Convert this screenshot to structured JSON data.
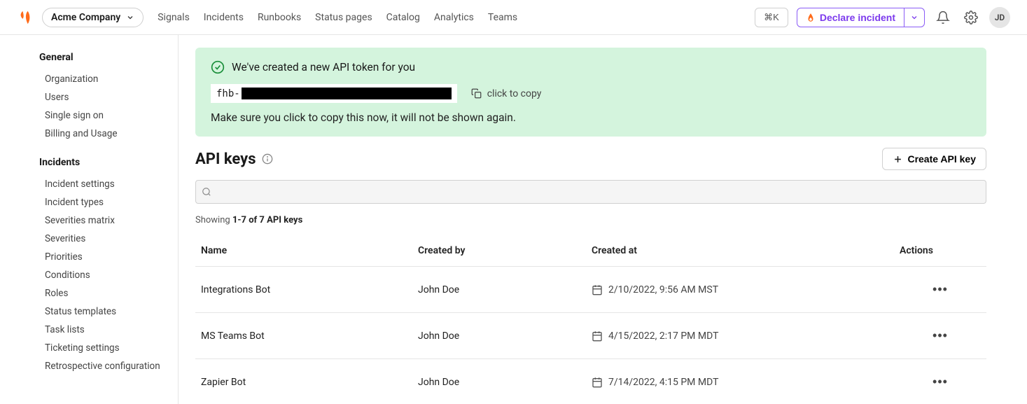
{
  "header": {
    "company": "Acme Company",
    "nav": [
      "Signals",
      "Incidents",
      "Runbooks",
      "Status pages",
      "Catalog",
      "Analytics",
      "Teams"
    ],
    "cmdKey": "⌘K",
    "declare": "Declare incident",
    "avatar": "JD"
  },
  "sidebar": {
    "sections": [
      {
        "title": "General",
        "items": [
          "Organization",
          "Users",
          "Single sign on",
          "Billing and Usage"
        ]
      },
      {
        "title": "Incidents",
        "items": [
          "Incident settings",
          "Incident types",
          "Severities matrix",
          "Severities",
          "Priorities",
          "Conditions",
          "Roles",
          "Status templates",
          "Task lists",
          "Ticketing settings",
          "Retrospective configuration"
        ]
      }
    ]
  },
  "banner": {
    "title": "We've created a new API token for you",
    "tokenPrefix": "fhb-",
    "copyLabel": "click to copy",
    "note": "Make sure you click to copy this now, it will not be shown again."
  },
  "page": {
    "title": "API keys",
    "createBtn": "Create API key",
    "showingPrefix": "Showing ",
    "showingBold": "1-7 of 7 API keys"
  },
  "table": {
    "columns": [
      "Name",
      "Created by",
      "Created at",
      "Actions"
    ],
    "rows": [
      {
        "name": "Integrations Bot",
        "createdBy": "John Doe",
        "createdAt": "2/10/2022, 9:56 AM MST"
      },
      {
        "name": "MS Teams Bot",
        "createdBy": "John Doe",
        "createdAt": "4/15/2022, 2:17 PM MDT"
      },
      {
        "name": "Zapier Bot",
        "createdBy": "John Doe",
        "createdAt": "7/14/2022, 4:15 PM MDT"
      }
    ]
  }
}
